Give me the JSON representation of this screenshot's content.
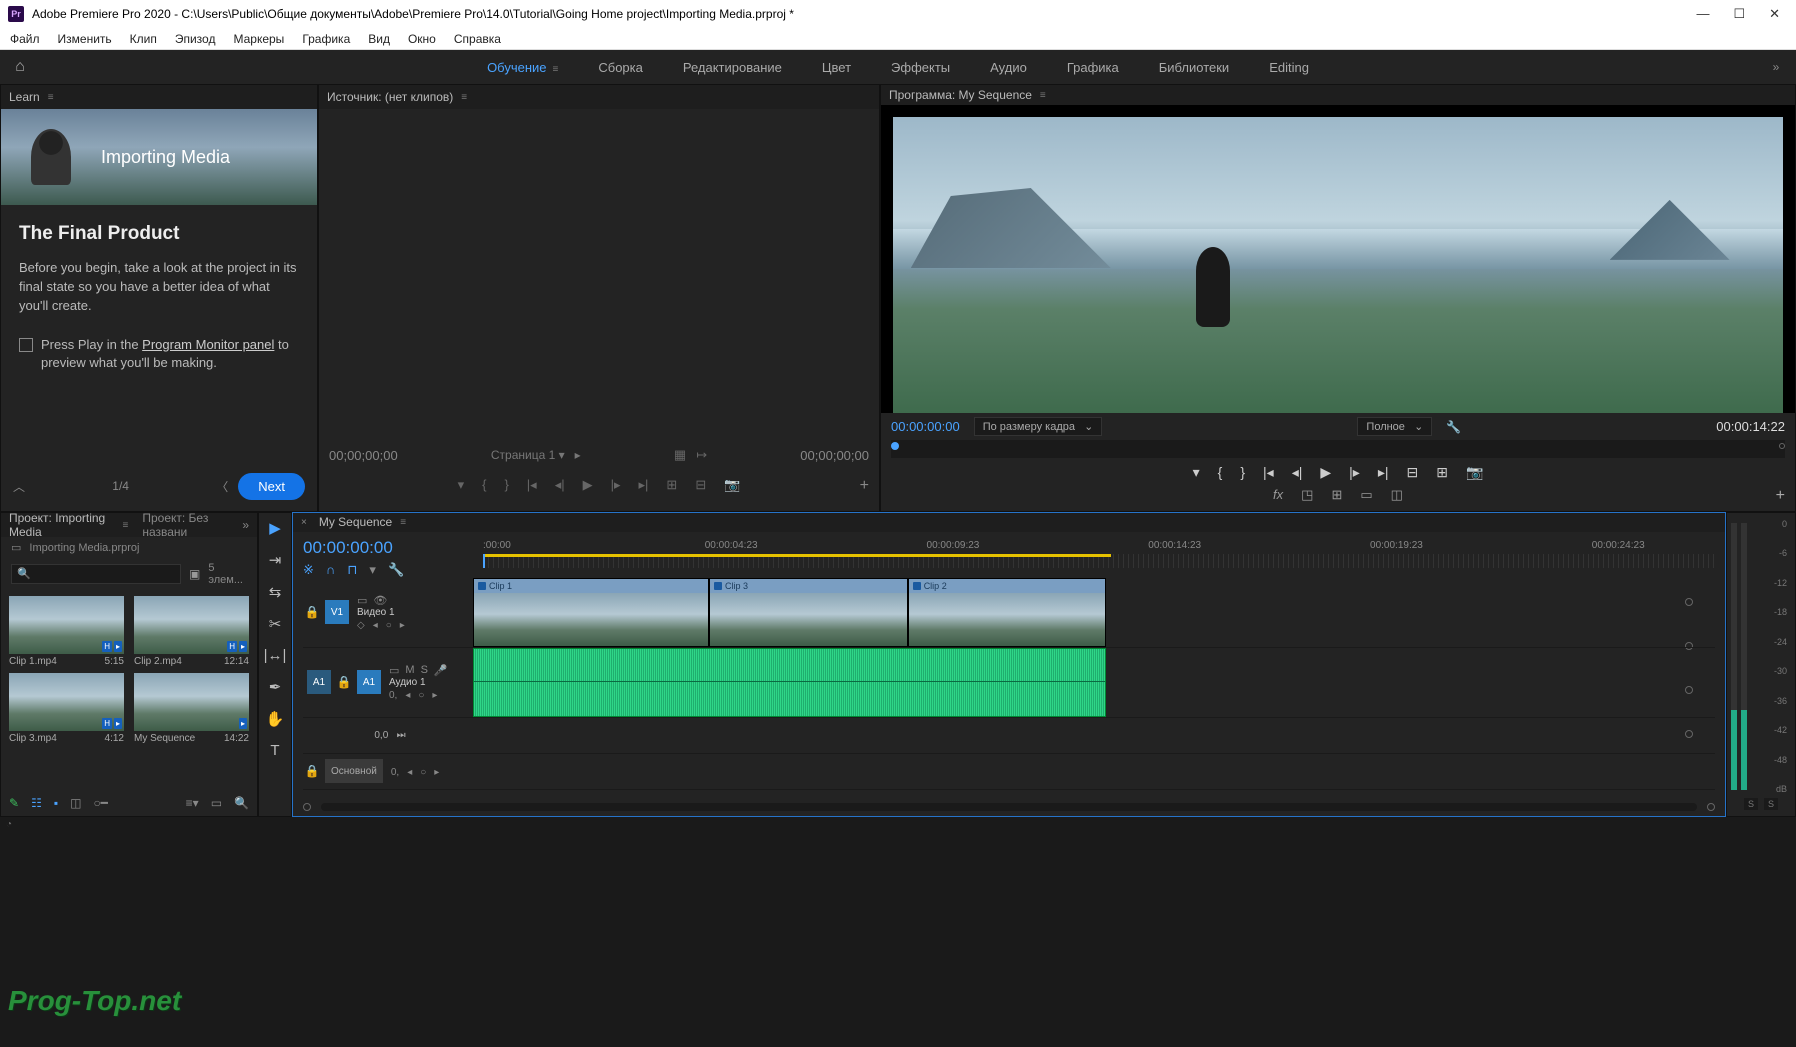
{
  "title": "Adobe Premiere Pro 2020 - C:\\Users\\Public\\Общие документы\\Adobe\\Premiere Pro\\14.0\\Tutorial\\Going Home project\\Importing Media.prproj *",
  "menu": [
    "Файл",
    "Изменить",
    "Клип",
    "Эпизод",
    "Маркеры",
    "Графика",
    "Вид",
    "Окно",
    "Справка"
  ],
  "workspaces": [
    "Обучение",
    "Сборка",
    "Редактирование",
    "Цвет",
    "Эффекты",
    "Аудио",
    "Графика",
    "Библиотеки",
    "Editing"
  ],
  "learn": {
    "tab": "Learn",
    "hero": "Importing Media",
    "h2": "The Final Product",
    "p": "Before you begin, take a look at the project in its final state so you have a better idea of what you'll create.",
    "check_pre": "Press Play in the ",
    "check_link": "Program Monitor panel",
    "check_post": " to preview what you'll be making.",
    "page": "1/4",
    "next": "Next"
  },
  "source": {
    "tab": "Источник: (нет клипов)",
    "tc1": "00;00;00;00",
    "drop": "Страница 1",
    "tc2": "00;00;00;00"
  },
  "program": {
    "tab": "Программа: My Sequence",
    "tc": "00:00:00:00",
    "fit": "По размеру кадра",
    "res": "Полное",
    "dur": "00:00:14:22"
  },
  "project": {
    "tab1": "Проект: Importing Media",
    "tab2": "Проект: Без названи",
    "file": "Importing Media.prproj",
    "count": "5 элем...",
    "clips": [
      {
        "name": "Clip 1.mp4",
        "dur": "5:15"
      },
      {
        "name": "Clip 2.mp4",
        "dur": "12:14"
      },
      {
        "name": "Clip 3.mp4",
        "dur": "4:12"
      },
      {
        "name": "My Sequence",
        "dur": "14:22"
      }
    ]
  },
  "timeline": {
    "tab": "My Sequence",
    "tc": "00:00:00:00",
    "ticks": [
      ":00:00",
      "00:00:04:23",
      "00:00:09:23",
      "00:00:14:23",
      "00:00:19:23",
      "00:00:24:23"
    ],
    "v1": "V1",
    "a1": "A1",
    "v1name": "Видео 1",
    "a1name": "Аудио 1",
    "master": "Основной",
    "vclips": [
      "Clip 1",
      "Clip 3",
      "Clip 2"
    ],
    "zero": "0,0",
    "zero2": "0,",
    "zero3": "0,"
  },
  "meters": {
    "ticks": [
      "0",
      "-6",
      "-12",
      "-18",
      "-24",
      "-30",
      "-36",
      "-42",
      "-48",
      "dB"
    ],
    "s": "S"
  },
  "watermark": "Prog-Top.net"
}
